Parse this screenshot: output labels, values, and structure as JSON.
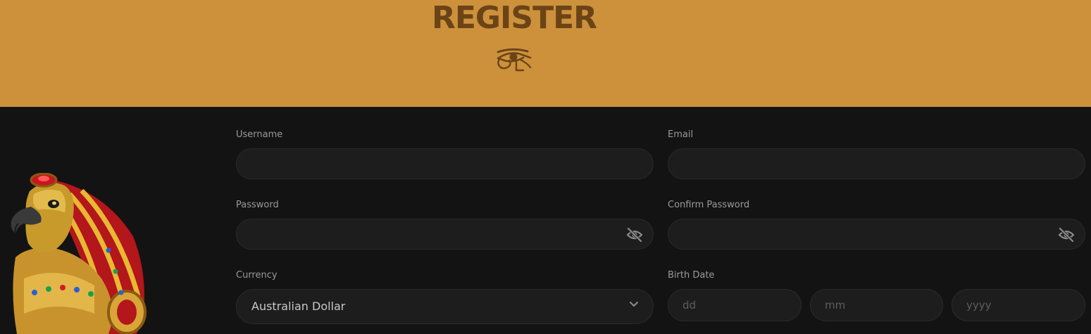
{
  "header": {
    "title": "REGISTER",
    "background_color": "#cd913c",
    "title_color": "#6b4416",
    "emblem_icon": "eye-of-horus-icon"
  },
  "form": {
    "username": {
      "label": "Username",
      "value": "",
      "placeholder": ""
    },
    "email": {
      "label": "Email",
      "value": "",
      "placeholder": ""
    },
    "password": {
      "label": "Password",
      "value": "",
      "placeholder": "",
      "toggle_icon": "eye-off-icon"
    },
    "confirm_password": {
      "label": "Confirm Password",
      "value": "",
      "placeholder": "",
      "toggle_icon": "eye-off-icon"
    },
    "currency": {
      "label": "Currency",
      "selected": "Australian Dollar",
      "icon": "chevron-down-icon"
    },
    "birth_date": {
      "label": "Birth Date",
      "day_placeholder": "dd",
      "month_placeholder": "mm",
      "year_placeholder": "yyyy"
    }
  },
  "decor": {
    "mascot": "horus-falcon-mascot"
  },
  "colors": {
    "page_background": "#131313",
    "field_background": "#1d1d1d",
    "label_text": "#9a9a9a"
  }
}
